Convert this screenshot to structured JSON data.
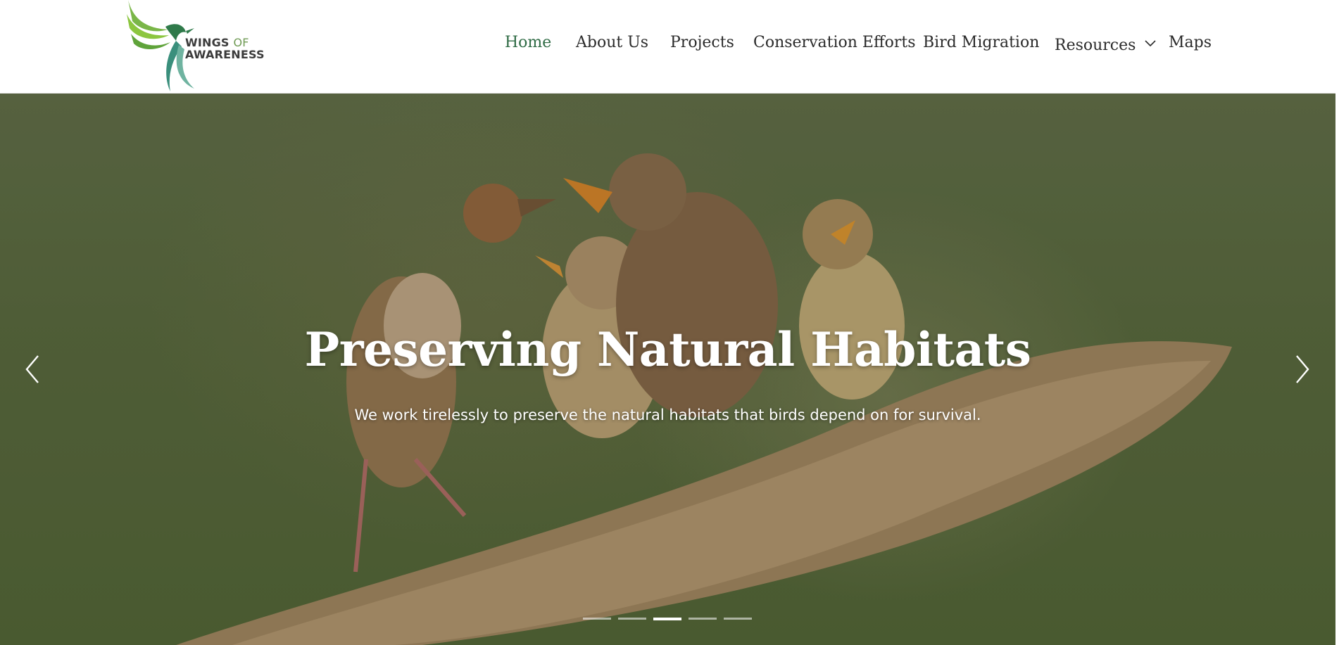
{
  "brand": {
    "line1_main": "WINGS",
    "line1_of": "OF",
    "line2": "AWARENESS",
    "colors": {
      "leaf_green": "#7ab648",
      "dark_green": "#2f7a4a",
      "teal": "#3a8f7c"
    }
  },
  "nav": {
    "items": [
      {
        "label": "Home",
        "active": true
      },
      {
        "label": "About Us",
        "active": false
      },
      {
        "label": "Projects",
        "active": false
      },
      {
        "label": "Conservation Efforts",
        "active": false
      },
      {
        "label": "Bird Migration",
        "active": false
      },
      {
        "label": "Resources",
        "active": false,
        "has_dropdown": true,
        "icon": "chevron-down-icon"
      },
      {
        "label": "Maps",
        "active": false
      }
    ],
    "active_color": "#2f6b45"
  },
  "hero": {
    "title": "Preserving Natural Habitats",
    "text": "We work tirelessly to preserve the natural habitats that birds depend on for survival.",
    "prev_icon": "chevron-left-icon",
    "next_icon": "chevron-right-icon",
    "slide_count": 5,
    "active_slide": 3
  }
}
